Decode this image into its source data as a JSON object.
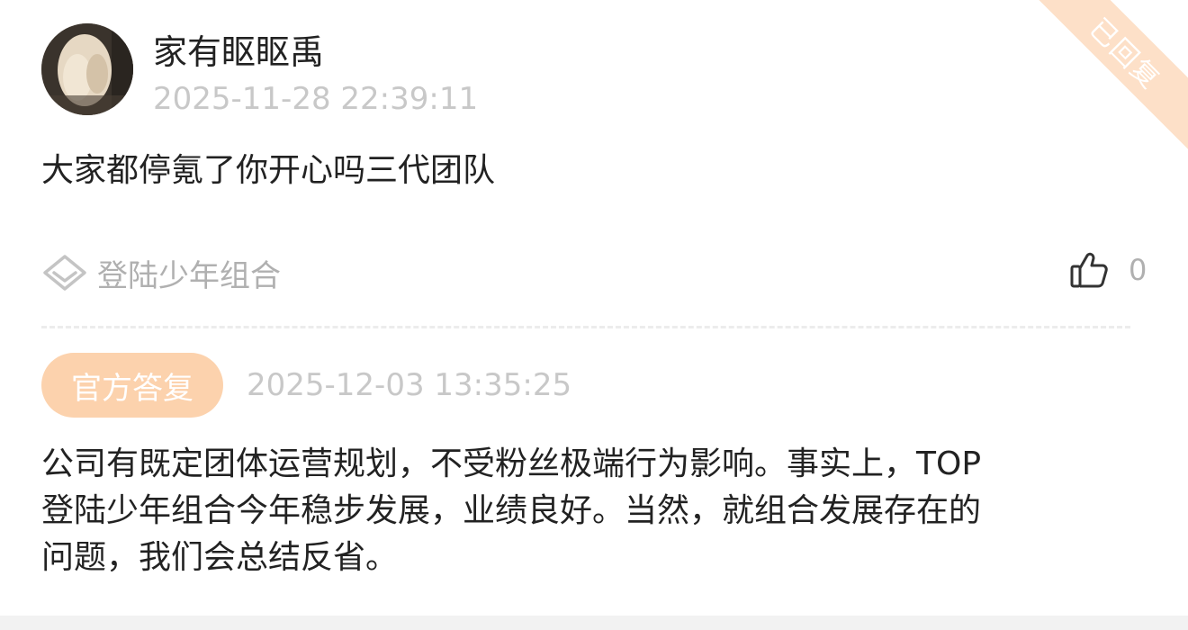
{
  "post": {
    "author": "家有眍眍禹",
    "timestamp": "2025-11-28 22:39:11",
    "question": "大家都停氪了你开心吗三代团队",
    "status_ribbon": "已回复",
    "tag": "登陆少年组合",
    "likes": "0"
  },
  "reply": {
    "badge": "官方答复",
    "timestamp": "2025-12-03 13:35:25",
    "lines": [
      "公司有既定团体运营规划，不受粉丝极端行为影响。事实上，TOP",
      "登陆少年组合今年稳步发展，业绩良好。当然，就组合发展存在的",
      "问题，我们会总结反省。"
    ]
  },
  "icons": {
    "tag": "diamond-tag-icon",
    "like": "thumbs-up-icon"
  },
  "colors": {
    "accent": "#fcd2ad",
    "ribbon": "#fde0c8",
    "muted_text": "#c8c8c8",
    "body_text": "#222222"
  }
}
